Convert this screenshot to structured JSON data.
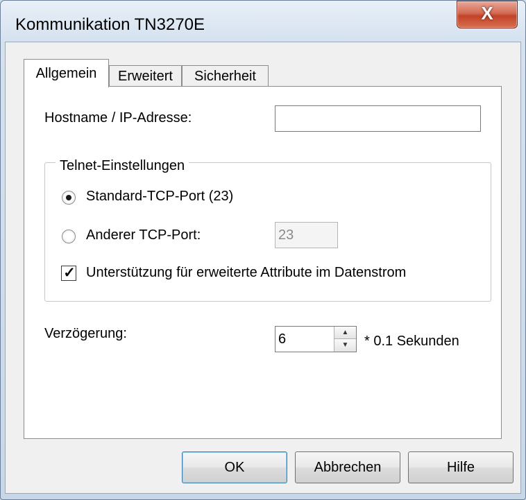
{
  "window": {
    "title": "Kommunikation TN3270E",
    "close_glyph": "X"
  },
  "tabs": [
    {
      "label": "Allgemein",
      "active": true
    },
    {
      "label": "Erweitert",
      "active": false
    },
    {
      "label": "Sicherheit",
      "active": false
    }
  ],
  "general": {
    "hostname_label": "Hostname / IP-Adresse:",
    "hostname_value": "",
    "telnet_group": {
      "legend": "Telnet-Einstellungen",
      "standard_port_label": "Standard-TCP-Port (23)",
      "standard_port_selected": true,
      "other_port_label": "Anderer TCP-Port:",
      "other_port_selected": false,
      "other_port_value": "23",
      "extended_attributes_label": "Unterstützung für erweiterte Attribute im Datenstrom",
      "extended_attributes_checked": true
    },
    "delay_label": "Verzögerung:",
    "delay_value": "6",
    "delay_unit": "* 0.1 Sekunden"
  },
  "buttons": {
    "ok": "OK",
    "cancel": "Abbrechen",
    "help": "Hilfe"
  }
}
